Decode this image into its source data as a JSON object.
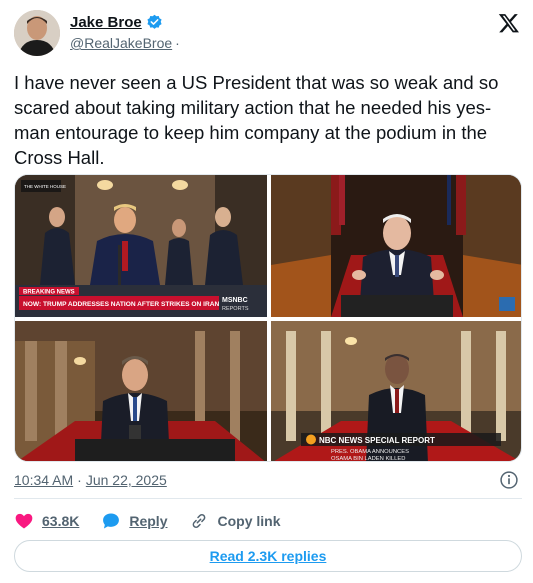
{
  "author": {
    "display_name": "Jake Broe",
    "handle": "@RealJakeBroe",
    "separator": "·",
    "verified": true
  },
  "tweet": {
    "text": "I have never seen a US President that was so weak and so scared about taking military action that he needed his yes-man entourage to keep him company at the podium in the Cross Hall."
  },
  "media": {
    "top_left": {
      "ticker_tag": "BREAKING NEWS",
      "headline": "NOW: TRUMP ADDRESSES NATION AFTER STRIKES ON IRAN",
      "network": "MSNBC",
      "network_sub": "REPORTS",
      "corner_tag": "THE WHITE HOUSE"
    },
    "bottom_right": {
      "banner": "NBC NEWS SPECIAL REPORT",
      "sub1": "PRES. OBAMA ANNOUNCES",
      "sub2": "OSAMA BIN LADEN KILLED"
    }
  },
  "meta": {
    "time": "10:34 AM",
    "separator": "·",
    "date": "Jun 22, 2025"
  },
  "actions": {
    "likes": "63.8K",
    "reply_label": "Reply",
    "copy_link_label": "Copy link"
  },
  "read_replies_label": "Read 2.3K replies",
  "colors": {
    "accent": "#1d9bf0",
    "like": "#f91880",
    "text": "#0f1419",
    "secondary": "#536471"
  },
  "icons": [
    "verified-badge-icon",
    "x-logo-icon",
    "info-icon",
    "heart-icon",
    "reply-bubble-icon",
    "link-icon"
  ]
}
